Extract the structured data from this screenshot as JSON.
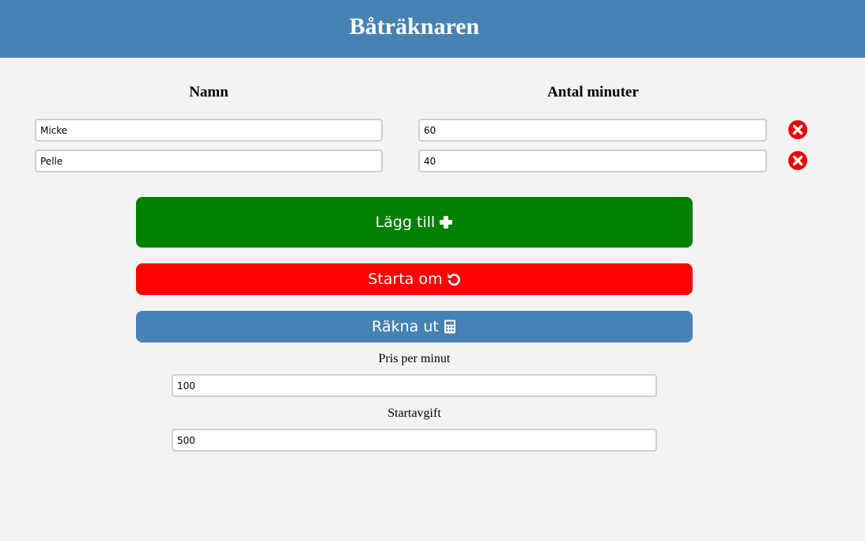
{
  "header": {
    "title": "Båträknaren"
  },
  "columns": {
    "name_label": "Namn",
    "minutes_label": "Antal minuter"
  },
  "rows": [
    {
      "name": "Micke",
      "minutes": "60",
      "remove_icon": "remove-circle-icon"
    },
    {
      "name": "Pelle",
      "minutes": "40",
      "remove_icon": "remove-circle-icon"
    }
  ],
  "buttons": {
    "add_label": "Lägg till",
    "add_icon": "plus-icon",
    "restart_label": "Starta om",
    "restart_icon": "undo-icon",
    "calc_label": "Räkna ut",
    "calc_icon": "calculator-icon"
  },
  "settings": {
    "price_label": "Pris per minut",
    "price_value": "100",
    "fee_label": "Startavgift",
    "fee_value": "500"
  },
  "colors": {
    "header": "#4682b4",
    "add": "#008000",
    "restart": "#ff0000",
    "calc": "#4682b4",
    "remove": "#ee0000",
    "background": "#f3f3f3"
  }
}
